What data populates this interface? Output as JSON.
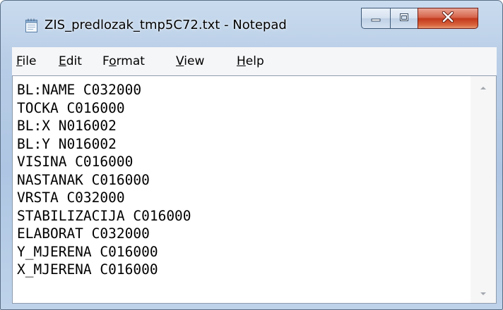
{
  "window": {
    "title": "ZIS_predlozak_tmp5C72.txt - Notepad",
    "icon": "notepad-icon",
    "controls": {
      "minimize": "minimize-icon",
      "maximize": "maximize-icon",
      "close": "close-icon"
    }
  },
  "menu": {
    "items": [
      {
        "label": "File",
        "mnemonic": "F",
        "rest": "ile"
      },
      {
        "label": "Edit",
        "mnemonic": "E",
        "rest": "dit"
      },
      {
        "label": "Format",
        "prefix": "F",
        "mnemonic": "o",
        "rest": "rmat"
      },
      {
        "label": "View",
        "mnemonic": "V",
        "rest": "iew"
      },
      {
        "label": "Help",
        "mnemonic": "H",
        "rest": "elp"
      }
    ]
  },
  "editor": {
    "lines": [
      "BL:NAME C032000",
      "TOCKA C016000",
      "BL:X N016002",
      "BL:Y N016002",
      "VISINA C016000",
      "NASTANAK C016000",
      "VRSTA C032000",
      "STABILIZACIJA C016000",
      "ELABORAT C032000",
      "Y_MJERENA C016000",
      "X_MJERENA C016000"
    ]
  },
  "colors": {
    "frame": "#b8cde6",
    "close_button": "#c3391c",
    "menubar": "#f5f6f8",
    "editor_background": "#ffffff"
  }
}
